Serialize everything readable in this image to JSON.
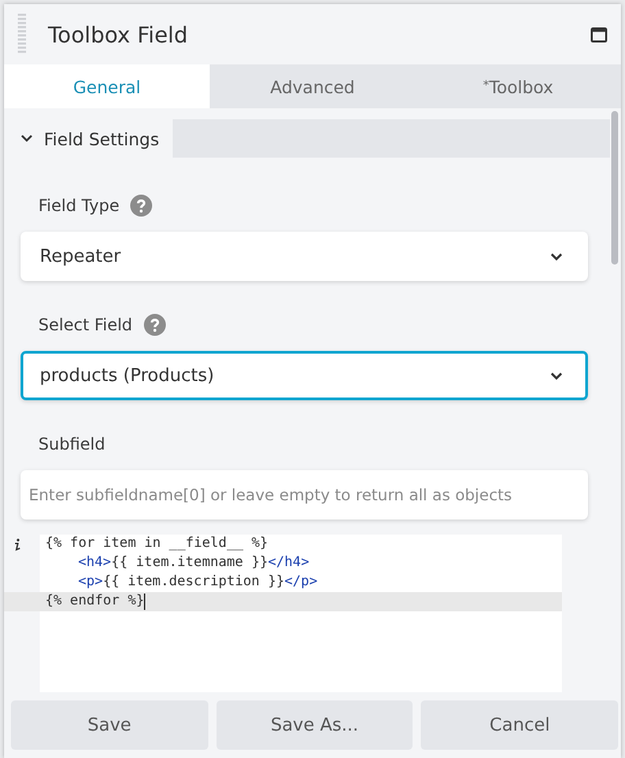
{
  "window": {
    "title": "Toolbox Field"
  },
  "tabs": [
    {
      "label": "General",
      "selected": true
    },
    {
      "label": "Advanced",
      "selected": false
    },
    {
      "label": "$^{*}$Toolbox",
      "selected": false
    }
  ],
  "section": {
    "title": "Field Settings",
    "expanded": true
  },
  "fields": [
    {
      "kind": "select",
      "label": "Field Type",
      "help": true,
      "value": "Repeater",
      "focused": false
    },
    {
      "kind": "select",
      "label": "Select Field",
      "help": true,
      "value": "products (Products)",
      "focused": true
    },
    {
      "kind": "text",
      "label": "Subfield",
      "help": false,
      "placeholder": "Enter subfieldname[0] or leave empty to return all as objects",
      "focused": false
    }
  ],
  "code": {
    "lines": [
      {
        "active": false,
        "info": true,
        "segments": [
          {
            "kind": "plain",
            "text": "{% for item in __field__ %}"
          }
        ]
      },
      {
        "active": false,
        "info": false,
        "indent": true,
        "segments": [
          {
            "kind": "tag",
            "text": "<h4>"
          },
          {
            "kind": "plain",
            "text": "{{ item.itemname }}"
          },
          {
            "kind": "tag",
            "text": "</h4>"
          }
        ]
      },
      {
        "active": false,
        "info": false,
        "indent": true,
        "segments": [
          {
            "kind": "tag",
            "text": "<p>"
          },
          {
            "kind": "plain",
            "text": "{{ item.description }}"
          },
          {
            "kind": "tag",
            "text": "</p>"
          }
        ]
      },
      {
        "active": true,
        "info": false,
        "segments": [
          {
            "kind": "plain",
            "text": "{% endfor %}"
          }
        ]
      }
    ]
  },
  "buttons": [
    "Save",
    "Save As...",
    "Cancel"
  ]
}
